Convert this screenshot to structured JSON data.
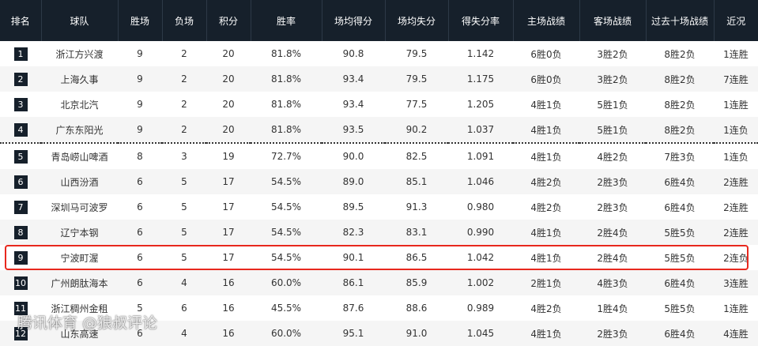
{
  "table": {
    "headers": [
      "排名",
      "球队",
      "胜场",
      "负场",
      "积分",
      "胜率",
      "场均得分",
      "场均失分",
      "得失分率",
      "主场战绩",
      "客场战绩",
      "过去十场战绩",
      "近况"
    ],
    "rows": [
      [
        "1",
        "浙江方兴渡",
        "9",
        "2",
        "20",
        "81.8%",
        "90.8",
        "79.5",
        "1.142",
        "6胜0负",
        "3胜2负",
        "8胜2负",
        "1连胜"
      ],
      [
        "2",
        "上海久事",
        "9",
        "2",
        "20",
        "81.8%",
        "93.4",
        "79.5",
        "1.175",
        "6胜0负",
        "3胜2负",
        "8胜2负",
        "7连胜"
      ],
      [
        "3",
        "北京北汽",
        "9",
        "2",
        "20",
        "81.8%",
        "93.4",
        "77.5",
        "1.205",
        "4胜1负",
        "5胜1负",
        "8胜2负",
        "1连胜"
      ],
      [
        "4",
        "广东东阳光",
        "9",
        "2",
        "20",
        "81.8%",
        "93.5",
        "90.2",
        "1.037",
        "4胜1负",
        "5胜1负",
        "8胜2负",
        "1连负"
      ],
      [
        "5",
        "青岛崂山啤酒",
        "8",
        "3",
        "19",
        "72.7%",
        "90.0",
        "82.5",
        "1.091",
        "4胜1负",
        "4胜2负",
        "7胜3负",
        "1连负"
      ],
      [
        "6",
        "山西汾酒",
        "6",
        "5",
        "17",
        "54.5%",
        "89.0",
        "85.1",
        "1.046",
        "4胜2负",
        "2胜3负",
        "6胜4负",
        "2连胜"
      ],
      [
        "7",
        "深圳马可波罗",
        "6",
        "5",
        "17",
        "54.5%",
        "89.5",
        "91.3",
        "0.980",
        "4胜2负",
        "2胜3负",
        "6胜4负",
        "2连胜"
      ],
      [
        "8",
        "辽宁本钢",
        "6",
        "5",
        "17",
        "54.5%",
        "82.3",
        "83.1",
        "0.990",
        "4胜1负",
        "2胜4负",
        "5胜5负",
        "2连胜"
      ],
      [
        "9",
        "宁波町渥",
        "6",
        "5",
        "17",
        "54.5%",
        "90.1",
        "86.5",
        "1.042",
        "4胜1负",
        "2胜4负",
        "5胜5负",
        "2连负"
      ],
      [
        "10",
        "广州朗肽海本",
        "6",
        "4",
        "16",
        "60.0%",
        "86.1",
        "85.9",
        "1.002",
        "2胜1负",
        "4胜3负",
        "6胜4负",
        "3连胜"
      ],
      [
        "11",
        "浙江稠州金租",
        "5",
        "6",
        "16",
        "45.5%",
        "87.6",
        "88.6",
        "0.989",
        "4胜2负",
        "1胜4负",
        "5胜5负",
        "1连胜"
      ],
      [
        "12",
        "山东高速",
        "6",
        "4",
        "16",
        "60.0%",
        "95.1",
        "91.0",
        "1.045",
        "4胜1负",
        "2胜3负",
        "6胜4负",
        "4连胜"
      ]
    ]
  },
  "watermark": "腾讯体育 @狼叔评论",
  "colors": {
    "header_bg": "#16202b",
    "rank_badge_bg": "#16202b",
    "highlight_border": "#e8281e",
    "stripe_bg": "#f5f5f5"
  }
}
